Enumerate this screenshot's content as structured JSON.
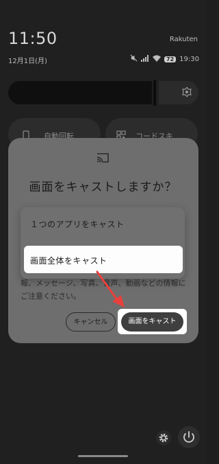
{
  "status": {
    "time": "11:50",
    "carrier": "Rakuten",
    "date": "12月1日(月)",
    "battery": "72",
    "clock_right": "19:30"
  },
  "tiles": {
    "left_label": "自動回転",
    "right_label": "コードスキ"
  },
  "dialog": {
    "title": "画面をキャストしますか？",
    "options": [
      "１つのアプリをキャスト",
      "画面全体をキャスト"
    ],
    "body": "報、メッセージ、写真、音声、動画などの情報にご注意ください。",
    "cancel_label": "キャンセル",
    "confirm_label": "画面をキャスト"
  },
  "annotation": {
    "arrow_color": "#e8403c",
    "highlight_color": "#ffffff"
  }
}
